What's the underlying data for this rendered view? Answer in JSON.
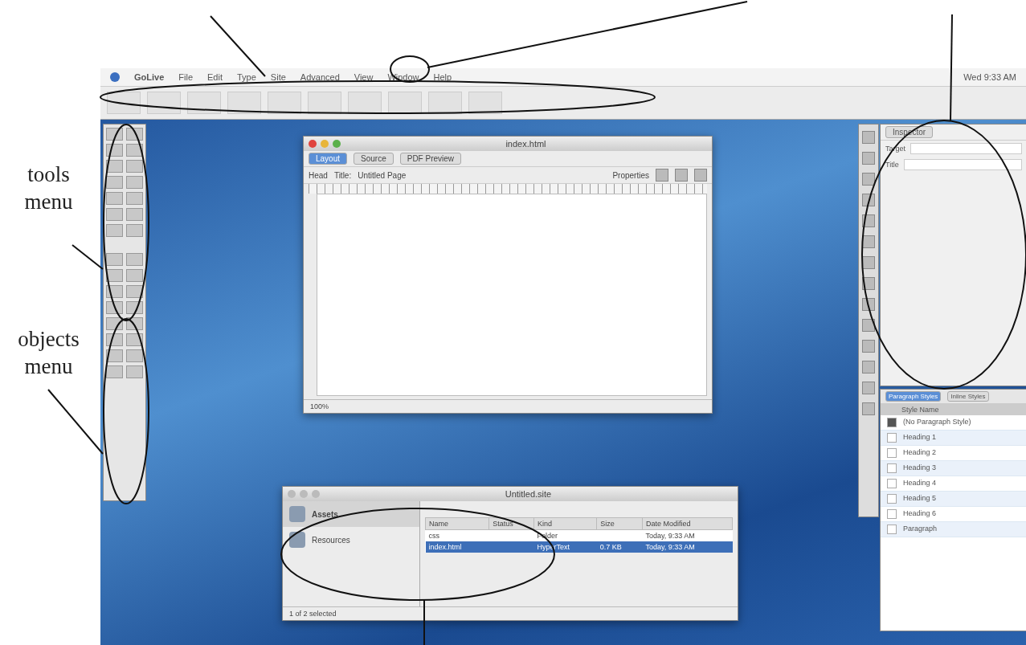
{
  "callouts": [
    {
      "label": "tools menu"
    },
    {
      "label": "objects menu"
    }
  ],
  "menubar": {
    "items": [
      "GoLive",
      "File",
      "Edit",
      "Type",
      "Site",
      "Advanced",
      "View",
      "Window",
      "Help"
    ],
    "clock": "Wed 9:33 AM"
  },
  "document_window": {
    "title": "index.html",
    "tabs": [
      {
        "label": "Layout",
        "selected": true
      },
      {
        "label": "Source",
        "selected": false
      },
      {
        "label": "PDF Preview",
        "selected": false
      }
    ],
    "head_label": "Head",
    "title_label": "Title:",
    "title_value": "Untitled Page",
    "properties_label": "Properties",
    "zoom": "100%"
  },
  "site_window": {
    "title": "Untitled.site",
    "sidebar": [
      {
        "label": "Assets",
        "selected": true
      },
      {
        "label": "Resources",
        "selected": false
      }
    ],
    "columns": [
      "Name",
      "Status",
      "Kind",
      "Size",
      "Date Modified"
    ],
    "rows": [
      {
        "name": "css",
        "kind": "Folder",
        "size": "",
        "date": "Today, 9:33 AM",
        "selected": false
      },
      {
        "name": "index.html",
        "kind": "HyperText",
        "size": "0.7 KB",
        "date": "Today, 9:33 AM",
        "selected": true
      }
    ],
    "status": "1 of 2 selected"
  },
  "inspector": {
    "tab": "Inspector",
    "fields": [
      "Target",
      "Title"
    ]
  },
  "styles_panel": {
    "tabs": [
      {
        "label": "Paragraph Styles",
        "selected": true
      },
      {
        "label": "Inline Styles",
        "selected": false
      }
    ],
    "column": "Style Name",
    "items": [
      {
        "label": "(No Paragraph Style)",
        "checked": true
      },
      {
        "label": "Heading 1",
        "checked": false
      },
      {
        "label": "Heading 2",
        "checked": false
      },
      {
        "label": "Heading 3",
        "checked": false
      },
      {
        "label": "Heading 4",
        "checked": false
      },
      {
        "label": "Heading 5",
        "checked": false
      },
      {
        "label": "Heading 6",
        "checked": false
      },
      {
        "label": "Paragraph",
        "checked": false
      }
    ]
  }
}
